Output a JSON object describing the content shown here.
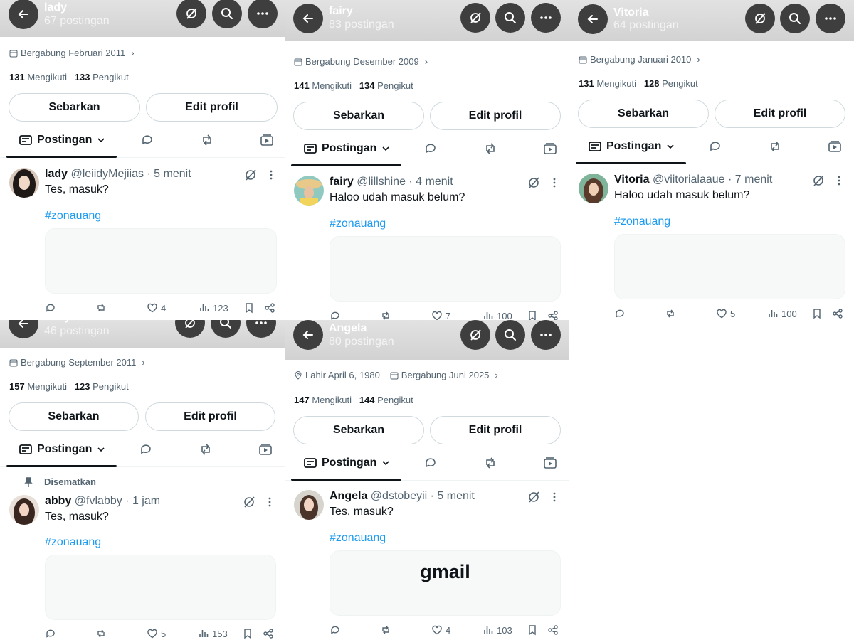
{
  "common": {
    "share_label": "Sebarkan",
    "edit_label": "Edit profil",
    "tab_posts": "Postingan",
    "following_label": "Mengikuti",
    "followers_label": "Pengikut",
    "hashtag": "#zonauang"
  },
  "panels": [
    {
      "name": "lady",
      "posts_count": "67 postingan",
      "joined": "Bergabung Februari 2011",
      "following": "131",
      "followers": "133",
      "post": {
        "name": "lady",
        "meta": "@leiidyMejiias · 5 menit",
        "text": "Tes, masuk?",
        "media_text": "",
        "replies": "",
        "reposts": "",
        "likes": "4",
        "views": "123"
      }
    },
    {
      "name": "fairy",
      "posts_count": "83 postingan",
      "joined": "Bergabung Desember 2009",
      "following": "141",
      "followers": "134",
      "post": {
        "name": "fairy",
        "meta": "@lillshine · 4 menit",
        "text": "Haloo udah masuk belum?",
        "media_text": "",
        "replies": "",
        "reposts": "",
        "likes": "7",
        "views": "100"
      }
    },
    {
      "name": "Vitoria",
      "posts_count": "64 postingan",
      "joined": "Bergabung Januari 2010",
      "following": "131",
      "followers": "128",
      "post": {
        "name": "Vitoria",
        "meta": "@viitorialaaue · 7 menit",
        "text": "Haloo udah masuk belum?",
        "media_text": "",
        "replies": "",
        "reposts": "",
        "likes": "5",
        "views": "100"
      }
    },
    {
      "name": "abby",
      "posts_count": "46 postingan",
      "joined": "Bergabung September 2011",
      "following": "157",
      "followers": "123",
      "pinned_label": "Disematkan",
      "post": {
        "name": "abby",
        "meta": "@fvlabby · 1 jam",
        "text": "Tes, masuk?",
        "media_text": "",
        "replies": "",
        "reposts": "",
        "likes": "5",
        "views": "153"
      }
    },
    {
      "name": "Angela",
      "posts_count": "80 postingan",
      "birth": "Lahir April 6, 1980",
      "joined": "Bergabung Juni 2025",
      "following": "147",
      "followers": "144",
      "post": {
        "name": "Angela",
        "meta": "@dstobeyii · 5 menit",
        "text": "Tes, masuk?",
        "media_text": "gmail",
        "replies": "",
        "reposts": "",
        "likes": "4",
        "views": "103"
      }
    }
  ],
  "colors": {
    "link": "#1d9bf0",
    "muted": "#536471",
    "text": "#0f1419",
    "button_dark": "#3e3e3e"
  },
  "icons": [
    "back-arrow-icon",
    "grok-icon",
    "search-icon",
    "more-icon",
    "calendar-icon",
    "location-icon",
    "chevron-right-icon",
    "posts-icon",
    "chevron-down-icon",
    "reply-icon",
    "repost-icon",
    "media-icon",
    "like-icon",
    "views-icon",
    "bookmark-icon",
    "share-icon",
    "pin-icon"
  ]
}
